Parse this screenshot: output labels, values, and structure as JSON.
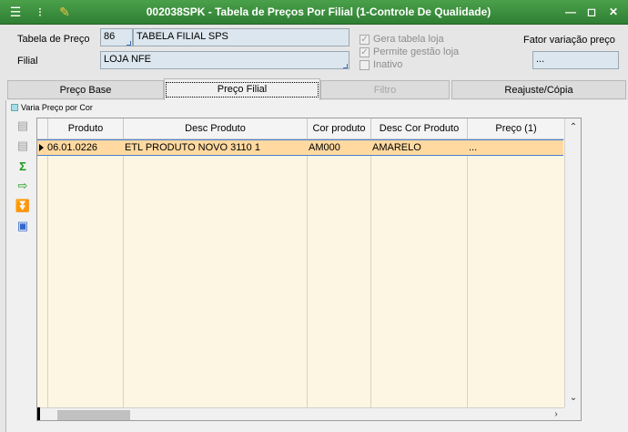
{
  "window": {
    "title": "002038SPK - Tabela de Preços Por Filial (1-Controle De Qualidade)",
    "buttons": {
      "minimize": "—",
      "maximize": "◻",
      "close": "✕"
    }
  },
  "header": {
    "tabela_label": "Tabela de  Preço",
    "tabela_code": "86",
    "tabela_name": "TABELA FILIAL SPS",
    "filial_label": "Filial",
    "filial_value": "LOJA NFE",
    "gera_tabela_loja": "Gera tabela loja",
    "permite_gestao_loja": "Permite gestão loja",
    "inativo": "Inativo",
    "fator_label": "Fator variação preço",
    "fator_value": "..."
  },
  "tabs": [
    {
      "label": "Preço Base",
      "state": "normal"
    },
    {
      "label": "Preço Filial",
      "state": "active"
    },
    {
      "label": "Filtro",
      "state": "disabled"
    },
    {
      "label": "Reajuste/Cópia",
      "state": "normal"
    }
  ],
  "vary_price_label": "Varia Preço por Cor",
  "grid": {
    "columns": [
      "Produto",
      "Desc Produto",
      "Cor produto",
      "Desc Cor Produto",
      "Preço (1)"
    ],
    "rows": [
      {
        "produto": "06.01.0226",
        "desc_produto": "ETL PRODUTO NOVO 3110 1",
        "cor_produto": "AM000",
        "desc_cor": "AMARELO",
        "preco": "..."
      }
    ]
  },
  "icons": {
    "menu": "menu-icon",
    "traffic": "traffic-light-icon",
    "tool": "wrench-icon",
    "sum": "sigma-icon",
    "export": "export-icon",
    "filter": "filter-down-icon",
    "image": "image-icon"
  }
}
